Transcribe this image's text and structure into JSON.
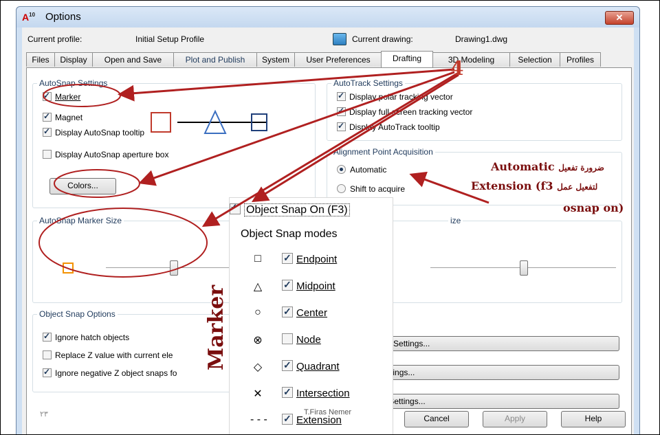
{
  "window": {
    "title": "Options",
    "app_icon_letter": "A",
    "app_icon_version": "10"
  },
  "profile": {
    "current_profile_label": "Current profile:",
    "current_profile_value": "Initial Setup Profile",
    "current_drawing_label": "Current drawing:",
    "current_drawing_value": "Drawing1.dwg"
  },
  "tabs": [
    "Files",
    "Display",
    "Open and Save",
    "Plot and Publish",
    "System",
    "User Preferences",
    "Drafting",
    "3D Modeling",
    "Selection",
    "Profiles"
  ],
  "active_tab": "Drafting",
  "autosnap": {
    "title": "AutoSnap Settings",
    "marker": "Marker",
    "magnet": "Magnet",
    "tooltip": "Display AutoSnap tooltip",
    "aperture": "Display AutoSnap aperture box",
    "colors": "Colors...",
    "marker_checked": true,
    "magnet_checked": true,
    "tooltip_checked": true,
    "aperture_checked": false
  },
  "autotrack": {
    "title": "AutoTrack Settings",
    "polar": "Display polar tracking vector",
    "fullscreen": "Display full-screen tracking vector",
    "tooltip": "Display AutoTrack tooltip"
  },
  "alignment": {
    "title": "Alignment Point Acquisition",
    "automatic": "Automatic",
    "shift": "Shift to acquire",
    "selected": "Automatic"
  },
  "marker_size": {
    "title": "AutoSnap Marker Size",
    "level": 0.35
  },
  "aperture_size": {
    "title_fragment": "ize",
    "level": 0.5
  },
  "osnap_options": {
    "title": "Object Snap Options",
    "ignore_hatch": "Ignore hatch objects",
    "replace_z": "Replace Z value with current ele",
    "ignore_negative_z": "Ignore negative Z object snaps fo"
  },
  "right_buttons": {
    "tooltip_settings": "ooltip Settings...",
    "lights": "h Settings...",
    "glyph": "lyph Settings..."
  },
  "footer": {
    "page_number": "٢٣",
    "cancel": "Cancel",
    "apply": "Apply",
    "help": "Help"
  },
  "popup": {
    "osnap_on": "Object Snap On (F3)",
    "modes_title": "Object Snap modes",
    "modes": [
      {
        "label": "Endpoint",
        "symbol": "□",
        "checked": true
      },
      {
        "label": "Midpoint",
        "symbol": "△",
        "checked": true
      },
      {
        "label": "Center",
        "symbol": "○",
        "checked": true
      },
      {
        "label": "Node",
        "symbol": "⊗",
        "checked": false
      },
      {
        "label": "Quadrant",
        "symbol": "◇",
        "checked": true
      },
      {
        "label": "Intersection",
        "symbol": "✕",
        "checked": true
      },
      {
        "label": "Extension",
        "symbol": "- - -",
        "checked": true
      }
    ],
    "credit": "T.Firas Nemer"
  },
  "annotations": {
    "number": "4",
    "vertical_label": "Marker",
    "arabic_line1_ar": "ضرورة تفعيل",
    "arabic_line1_en": "Automatic",
    "arabic_line2_ar": "لتفعيل عمل",
    "arabic_line2_en": "Extension (f3",
    "arabic_line3": "osnap on)"
  },
  "colors": {
    "annotation_red": "#b02020",
    "marker_orange": "#f39200",
    "marker_blue": "#3a5ea8"
  }
}
